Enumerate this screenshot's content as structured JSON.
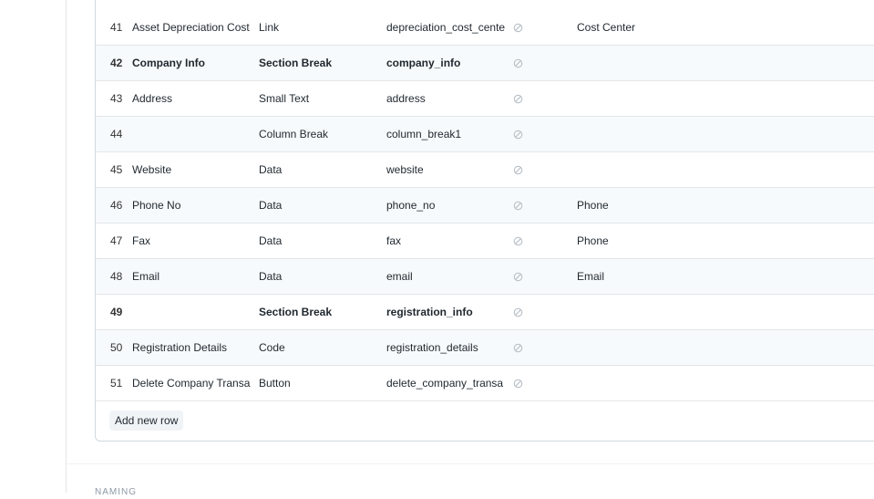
{
  "grid": {
    "rows": [
      {
        "idx": "41",
        "label": "Asset Depreciation Cost",
        "type": "Link",
        "fieldname": "depreciation_cost_cente",
        "required_icon": "circle-slash-icon",
        "options": "Cost Center",
        "bold": false
      },
      {
        "idx": "42",
        "label": "Company Info",
        "type": "Section Break",
        "fieldname": "company_info",
        "required_icon": "circle-slash-icon",
        "options": "",
        "bold": true
      },
      {
        "idx": "43",
        "label": "Address",
        "type": "Small Text",
        "fieldname": "address",
        "required_icon": "circle-slash-icon",
        "options": "",
        "bold": false
      },
      {
        "idx": "44",
        "label": "",
        "type": "Column Break",
        "fieldname": "column_break1",
        "required_icon": "circle-slash-icon",
        "options": "",
        "bold": false
      },
      {
        "idx": "45",
        "label": "Website",
        "type": "Data",
        "fieldname": "website",
        "required_icon": "circle-slash-icon",
        "options": "",
        "bold": false
      },
      {
        "idx": "46",
        "label": "Phone No",
        "type": "Data",
        "fieldname": "phone_no",
        "required_icon": "circle-slash-icon",
        "options": "Phone",
        "bold": false
      },
      {
        "idx": "47",
        "label": "Fax",
        "type": "Data",
        "fieldname": "fax",
        "required_icon": "circle-slash-icon",
        "options": "Phone",
        "bold": false
      },
      {
        "idx": "48",
        "label": "Email",
        "type": "Data",
        "fieldname": "email",
        "required_icon": "circle-slash-icon",
        "options": "Email",
        "bold": false
      },
      {
        "idx": "49",
        "label": "",
        "type": "Section Break",
        "fieldname": "registration_info",
        "required_icon": "circle-slash-icon",
        "options": "",
        "bold": true
      },
      {
        "idx": "50",
        "label": "Registration Details",
        "type": "Code",
        "fieldname": "registration_details",
        "required_icon": "circle-slash-icon",
        "options": "",
        "bold": false
      },
      {
        "idx": "51",
        "label": "Delete Company Transa",
        "type": "Button",
        "fieldname": "delete_company_transa",
        "required_icon": "circle-slash-icon",
        "options": "",
        "bold": false
      }
    ],
    "add_row_label": "Add new row"
  },
  "next_section": {
    "label": "NAMING"
  }
}
